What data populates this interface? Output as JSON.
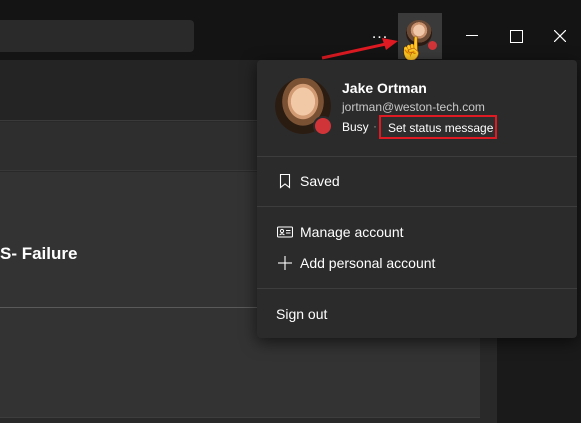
{
  "titlebar": {
    "more_label": "...",
    "window_controls": [
      "minimize",
      "maximize",
      "close"
    ],
    "presence_color": "#d13438"
  },
  "main": {
    "card_title": "S- Failure"
  },
  "profile_menu": {
    "name": "Jake Ortman",
    "email": "jortman@weston-tech.com",
    "status": "Busy",
    "status_separator": "·",
    "set_status_label": "Set status message",
    "saved_label": "Saved",
    "manage_account_label": "Manage account",
    "add_personal_account_label": "Add personal account",
    "sign_out_label": "Sign out"
  },
  "annotation": {
    "highlight_color": "#e01a22"
  }
}
